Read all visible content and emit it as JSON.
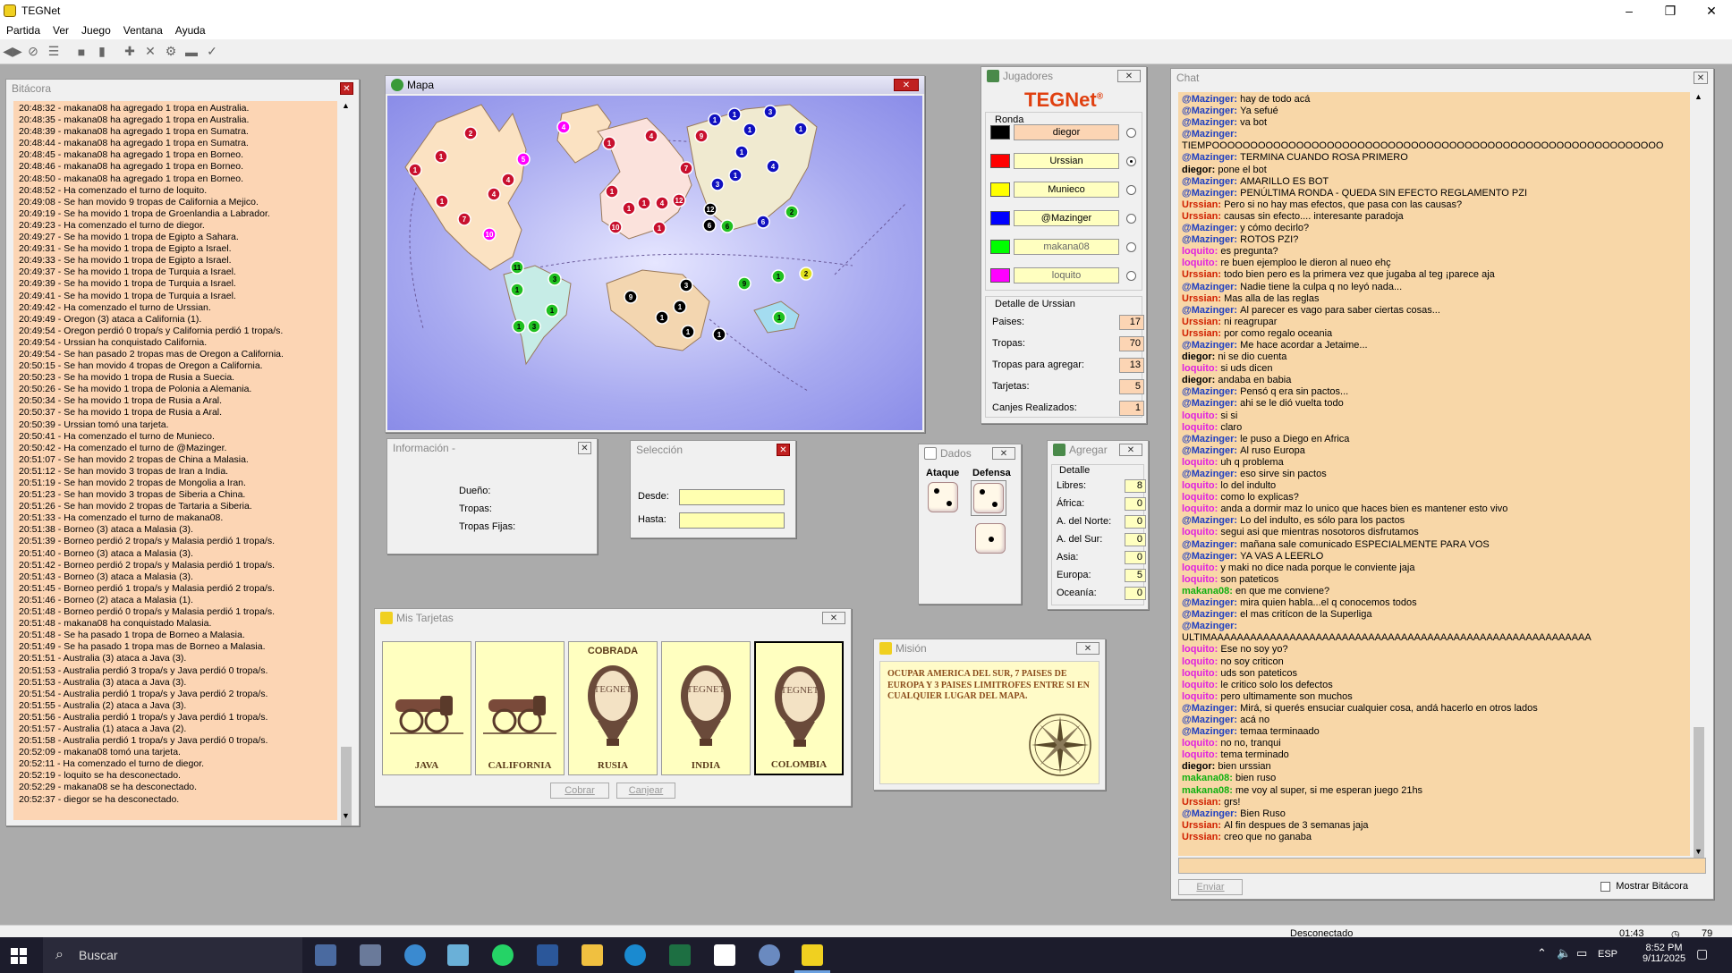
{
  "window": {
    "title": "TEGNet",
    "min": "–",
    "max": "❐",
    "close": "✕"
  },
  "menu": [
    "Partida",
    "Ver",
    "Juego",
    "Ventana",
    "Ayuda"
  ],
  "log": {
    "title": "Bitácora",
    "lines": [
      "20:48:32 - makana08 ha agregado 1 tropa en Australia.",
      "20:48:35 - makana08 ha agregado 1 tropa en Australia.",
      "20:48:39 - makana08 ha agregado 1 tropa en Sumatra.",
      "20:48:44 - makana08 ha agregado 1 tropa en Sumatra.",
      "20:48:45 - makana08 ha agregado 1 tropa en Borneo.",
      "20:48:46 - makana08 ha agregado 1 tropa en Borneo.",
      "20:48:50 - makana08 ha agregado 1 tropa en Borneo.",
      "20:48:52 - Ha comenzado el turno de loquito.",
      "20:49:08 - Se han movido 9 tropas de California a Mejico.",
      "20:49:19 - Se ha movido 1 tropa de Groenlandia a Labrador.",
      "20:49:23 - Ha comenzado el turno de diegor.",
      "20:49:27 - Se ha movido 1 tropa de Egipto a Sahara.",
      "20:49:31 - Se ha movido 1 tropa de Egipto a Israel.",
      "20:49:33 - Se ha movido 1 tropa de Egipto a Israel.",
      "20:49:37 - Se ha movido 1 tropa de Turquia a Israel.",
      "20:49:39 - Se ha movido 1 tropa de Turquia a Israel.",
      "20:49:41 - Se ha movido 1 tropa de Turquia a Israel.",
      "20:49:42 - Ha comenzado el turno de Urssian.",
      "20:49:49 - Oregon (3) ataca a California (1).",
      "20:49:54 - Oregon perdió 0 tropa/s y California perdió 1 tropa/s.",
      "20:49:54 - Urssian ha conquistado California.",
      "20:49:54 - Se han pasado 2 tropas mas de Oregon a California.",
      "20:50:15 - Se han movido 4 tropas de Oregon a California.",
      "20:50:23 - Se ha movido 1 tropa de Rusia a Suecia.",
      "20:50:26 - Se ha movido 1 tropa de Polonia a Alemania.",
      "20:50:34 - Se ha movido 1 tropa de Rusia a Aral.",
      "20:50:37 - Se ha movido 1 tropa de Rusia a Aral.",
      "20:50:39 - Urssian tomó una tarjeta.",
      "20:50:41 - Ha comenzado el turno de Munieco.",
      "20:50:42 - Ha comenzado el turno de @Mazinger.",
      "20:51:07 - Se han movido 2 tropas de China a Malasia.",
      "20:51:12 - Se han movido 3 tropas de Iran a India.",
      "20:51:19 - Se han movido 2 tropas de Mongolia a Iran.",
      "20:51:23 - Se han movido 3 tropas de Siberia a China.",
      "20:51:26 - Se han movido 2 tropas de Tartaria a Siberia.",
      "20:51:33 - Ha comenzado el turno de makana08.",
      "20:51:38 - Borneo (3) ataca a Malasia (3).",
      "20:51:39 - Borneo perdió 2 tropa/s y Malasia perdió 1 tropa/s.",
      "20:51:40 - Borneo (3) ataca a Malasia (3).",
      "20:51:42 - Borneo perdió 2 tropa/s y Malasia perdió 1 tropa/s.",
      "20:51:43 - Borneo (3) ataca a Malasia (3).",
      "20:51:45 - Borneo perdió 1 tropa/s y Malasia perdió 2 tropa/s.",
      "20:51:46 - Borneo (2) ataca a Malasia (1).",
      "20:51:48 - Borneo perdió 0 tropa/s y Malasia perdió 1 tropa/s.",
      "20:51:48 - makana08 ha conquistado Malasia.",
      "20:51:48 - Se ha pasado 1 tropa de Borneo a Malasia.",
      "20:51:49 - Se ha pasado 1 tropa mas de Borneo a Malasia.",
      "20:51:51 - Australia (3) ataca a Java (3).",
      "20:51:53 - Australia perdió 3 tropa/s y Java perdió 0 tropa/s.",
      "20:51:53 - Australia (3) ataca a Java (3).",
      "20:51:54 - Australia perdió 1 tropa/s y Java perdió 2 tropa/s.",
      "20:51:55 - Australia (2) ataca a Java (3).",
      "20:51:56 - Australia perdió 1 tropa/s y Java perdió 1 tropa/s.",
      "20:51:57 - Australia (1) ataca a Java (2).",
      "20:51:58 - Australia perdió 1 tropa/s y Java perdió 0 tropa/s.",
      "20:52:09 - makana08 tomó una tarjeta.",
      "20:52:11 - Ha comenzado el turno de diegor.",
      "20:52:19 - loquito se ha desconectado.",
      "20:52:29 - makana08 se ha desconectado.",
      "20:52:37 - diegor se ha desconectado."
    ]
  },
  "map": {
    "title": "Mapa",
    "markers": [
      {
        "n": "2",
        "c": "#c8102e"
      },
      {
        "n": "1",
        "c": "#c8102e"
      },
      {
        "n": "1",
        "c": "#c8102e"
      },
      {
        "n": "4",
        "c": "#c8102e"
      },
      {
        "n": "4",
        "c": "#c8102e"
      },
      {
        "n": "1",
        "c": "#c8102e"
      },
      {
        "n": "7",
        "c": "#c8102e"
      },
      {
        "n": "5",
        "c": "#ff00ff"
      },
      {
        "n": "4",
        "c": "#ff00ff"
      },
      {
        "n": "10",
        "c": "#ff00ff"
      },
      {
        "n": "1",
        "c": "#c8102e"
      },
      {
        "n": "4",
        "c": "#c8102e"
      },
      {
        "n": "1",
        "c": "#c8102e"
      },
      {
        "n": "7",
        "c": "#c8102e"
      },
      {
        "n": "9",
        "c": "#c8102e"
      },
      {
        "n": "4",
        "c": "#c8102e"
      },
      {
        "n": "1",
        "c": "#c8102e"
      },
      {
        "n": "12",
        "c": "#c8102e"
      },
      {
        "n": "10",
        "c": "#c8102e"
      },
      {
        "n": "1",
        "c": "#c8102e"
      },
      {
        "n": "1",
        "c": "#c8102e"
      },
      {
        "n": "1",
        "c": "#1010c0"
      },
      {
        "n": "1",
        "c": "#1010c0"
      },
      {
        "n": "1",
        "c": "#1010c0"
      },
      {
        "n": "3",
        "c": "#1010c0"
      },
      {
        "n": "1",
        "c": "#1010c0"
      },
      {
        "n": "1",
        "c": "#1010c0"
      },
      {
        "n": "1",
        "c": "#1010c0"
      },
      {
        "n": "4",
        "c": "#1010c0"
      },
      {
        "n": "3",
        "c": "#1010c0"
      },
      {
        "n": "6",
        "c": "#1010c0"
      },
      {
        "n": "2",
        "c": "#20c020"
      },
      {
        "n": "12",
        "c": "#000000"
      },
      {
        "n": "6",
        "c": "#000000"
      },
      {
        "n": "6",
        "c": "#20c020"
      },
      {
        "n": "11",
        "c": "#20c020"
      },
      {
        "n": "3",
        "c": "#20c020"
      },
      {
        "n": "1",
        "c": "#20c020"
      },
      {
        "n": "1",
        "c": "#20c020"
      },
      {
        "n": "1",
        "c": "#20c020"
      },
      {
        "n": "3",
        "c": "#20c020"
      },
      {
        "n": "3",
        "c": "#000000"
      },
      {
        "n": "9",
        "c": "#000000"
      },
      {
        "n": "1",
        "c": "#000000"
      },
      {
        "n": "1",
        "c": "#000000"
      },
      {
        "n": "1",
        "c": "#000000"
      },
      {
        "n": "1",
        "c": "#000000"
      },
      {
        "n": "9",
        "c": "#20c020"
      },
      {
        "n": "1",
        "c": "#20c020"
      },
      {
        "n": "2",
        "c": "#e0e020"
      },
      {
        "n": "1",
        "c": "#20c020"
      }
    ]
  },
  "info": {
    "title": "Información -",
    "owner": "Dueño:",
    "troops": "Tropas:",
    "fixed": "Tropas Fijas:"
  },
  "selection": {
    "title": "Selección",
    "from": "Desde:",
    "to": "Hasta:"
  },
  "players": {
    "title": "Jugadores",
    "logo": "TEGNet",
    "logo_reg": "®",
    "round_label": "Ronda",
    "list": [
      {
        "name": "diegor",
        "color": "#000000",
        "active": false,
        "highlight": true
      },
      {
        "name": "Urssian",
        "color": "#ff0000",
        "active": true,
        "highlight": false
      },
      {
        "name": "Munieco",
        "color": "#ffff00",
        "active": false,
        "highlight": false
      },
      {
        "name": "@Mazinger",
        "color": "#0000ff",
        "active": false,
        "highlight": false
      },
      {
        "name": "makana08",
        "color": "#00ff00",
        "active": false,
        "highlight": false
      },
      {
        "name": "loquito",
        "color": "#ff00ff",
        "active": false,
        "highlight": false
      }
    ],
    "detail_title": "Detalle de Urssian",
    "stats": [
      {
        "label": "Paises:",
        "value": "17"
      },
      {
        "label": "Tropas:",
        "value": "70"
      },
      {
        "label": "Tropas para agregar:",
        "value": "13"
      },
      {
        "label": "Tarjetas:",
        "value": "5"
      },
      {
        "label": "Canjes Realizados:",
        "value": "1"
      }
    ]
  },
  "dice": {
    "title": "Dados",
    "attack": "Ataque",
    "defense": "Defensa"
  },
  "add": {
    "title": "Agregar",
    "detail": "Detalle",
    "rows": [
      {
        "label": "Libres:",
        "value": "8"
      },
      {
        "label": "África:",
        "value": "0"
      },
      {
        "label": "A. del Norte:",
        "value": "0"
      },
      {
        "label": "A. del Sur:",
        "value": "0"
      },
      {
        "label": "Asia:",
        "value": "0"
      },
      {
        "label": "Europa:",
        "value": "5"
      },
      {
        "label": "Oceanía:",
        "value": "0"
      }
    ]
  },
  "cards": {
    "title": "Mis Tarjetas",
    "list": [
      {
        "name": "JAVA",
        "kind": "canon",
        "top": ""
      },
      {
        "name": "CALIFORNIA",
        "kind": "canon",
        "top": ""
      },
      {
        "name": "RUSIA",
        "kind": "balloon",
        "top": "COBRADA"
      },
      {
        "name": "INDIA",
        "kind": "balloon",
        "top": ""
      },
      {
        "name": "COLOMBIA",
        "kind": "balloon",
        "top": ""
      }
    ],
    "balloon_text": "TEGNET",
    "collect": "Cobrar",
    "exchange": "Canjear"
  },
  "mission": {
    "title": "Misión",
    "text": "OCUPAR AMERICA DEL SUR, 7 PAISES DE EUROPA Y 3 PAISES LIMITROFES ENTRE SI EN CUALQUIER LUGAR DEL MAPA."
  },
  "chat": {
    "title": "Chat",
    "send": "Enviar",
    "show_log": "Mostrar Bitácora",
    "lines": [
      {
        "u": "@Mazinger:",
        "c": "#2040c0",
        "m": "hay de todo acá"
      },
      {
        "u": "@Mazinger:",
        "c": "#2040c0",
        "m": "Ya sefué"
      },
      {
        "u": "@Mazinger:",
        "c": "#2040c0",
        "m": "va bot"
      },
      {
        "u": "@Mazinger:",
        "c": "#2040c0",
        "m": ""
      },
      {
        "u": "",
        "c": "#000",
        "m": "TIEMPOOOOOOOOOOOOOOOOOOOOOOOOOOOOOOOOOOOOOOOOOOOOOOOOOOOOOOOOOOO"
      },
      {
        "u": "@Mazinger:",
        "c": "#2040c0",
        "m": "TERMINA CUANDO ROSA PRIMERO"
      },
      {
        "u": "diegor:",
        "c": "#000",
        "m": "pone el bot"
      },
      {
        "u": "@Mazinger:",
        "c": "#2040c0",
        "m": "AMARILLO ES BOT"
      },
      {
        "u": "@Mazinger:",
        "c": "#2040c0",
        "m": "PENÚLTIMA RONDA - QUEDA SIN EFECTO REGLAMENTO PZI"
      },
      {
        "u": "Urssian:",
        "c": "#d02000",
        "m": "Pero si no hay mas efectos, que pasa con las causas?"
      },
      {
        "u": "Urssian:",
        "c": "#d02000",
        "m": "causas sin efecto.... interesante paradoja"
      },
      {
        "u": "@Mazinger:",
        "c": "#2040c0",
        "m": "y cómo decirlo?"
      },
      {
        "u": "@Mazinger:",
        "c": "#2040c0",
        "m": "ROTOS PZI?"
      },
      {
        "u": "loquito:",
        "c": "#e020e0",
        "m": "es pregunta?"
      },
      {
        "u": "loquito:",
        "c": "#e020e0",
        "m": "re buen ejemploo le dieron al nueo ehç"
      },
      {
        "u": "Urssian:",
        "c": "#d02000",
        "m": "todo bien pero es la primera vez que jugaba al teg ¡parece aja"
      },
      {
        "u": "@Mazinger:",
        "c": "#2040c0",
        "m": "Nadie tiene la culpa q no leyó nada..."
      },
      {
        "u": "Urssian:",
        "c": "#d02000",
        "m": "Mas alla de las reglas"
      },
      {
        "u": "@Mazinger:",
        "c": "#2040c0",
        "m": "Al parecer es vago para saber ciertas cosas..."
      },
      {
        "u": "Urssian:",
        "c": "#d02000",
        "m": "ni reagrupar"
      },
      {
        "u": "Urssian:",
        "c": "#d02000",
        "m": "por como regalo oceania"
      },
      {
        "u": "@Mazinger:",
        "c": "#2040c0",
        "m": "Me hace acordar a Jetaime..."
      },
      {
        "u": "diegor:",
        "c": "#000",
        "m": "ni se dio cuenta"
      },
      {
        "u": "loquito:",
        "c": "#e020e0",
        "m": "si uds dicen"
      },
      {
        "u": "diegor:",
        "c": "#000",
        "m": "andaba en babia"
      },
      {
        "u": "@Mazinger:",
        "c": "#2040c0",
        "m": "Pensó q era sin pactos..."
      },
      {
        "u": "@Mazinger:",
        "c": "#2040c0",
        "m": "ahi se le dió vuelta todo"
      },
      {
        "u": "loquito:",
        "c": "#e020e0",
        "m": "si si"
      },
      {
        "u": "loquito:",
        "c": "#e020e0",
        "m": "claro"
      },
      {
        "u": "@Mazinger:",
        "c": "#2040c0",
        "m": "le puso a Diego en Africa"
      },
      {
        "u": "@Mazinger:",
        "c": "#2040c0",
        "m": "Al ruso Europa"
      },
      {
        "u": "loquito:",
        "c": "#e020e0",
        "m": "uh q problema"
      },
      {
        "u": "@Mazinger:",
        "c": "#2040c0",
        "m": "eso sirve sin pactos"
      },
      {
        "u": "loquito:",
        "c": "#e020e0",
        "m": "lo del indulto"
      },
      {
        "u": "loquito:",
        "c": "#e020e0",
        "m": "como lo explicas?"
      },
      {
        "u": "loquito:",
        "c": "#e020e0",
        "m": "anda a dormir maz lo unico que haces bien es mantener esto vivo"
      },
      {
        "u": "@Mazinger:",
        "c": "#2040c0",
        "m": "Lo del indulto, es sólo para los pactos"
      },
      {
        "u": "loquito:",
        "c": "#e020e0",
        "m": "segui asi que mientras nosotoros disfrutamos"
      },
      {
        "u": "@Mazinger:",
        "c": "#2040c0",
        "m": "mañana sale comunicado ESPECIALMENTE PARA VOS"
      },
      {
        "u": "@Mazinger:",
        "c": "#2040c0",
        "m": "YA VAS A LEERLO"
      },
      {
        "u": "loquito:",
        "c": "#e020e0",
        "m": "y maki no dice nada porque le conviente jaja"
      },
      {
        "u": "loquito:",
        "c": "#e020e0",
        "m": "son pateticos"
      },
      {
        "u": "makana08:",
        "c": "#10b010",
        "m": "en que me conviene?"
      },
      {
        "u": "@Mazinger:",
        "c": "#2040c0",
        "m": "mira quien habla...el q conocemos todos"
      },
      {
        "u": "@Mazinger:",
        "c": "#2040c0",
        "m": "el mas critícon de la Superliga"
      },
      {
        "u": "@Mazinger:",
        "c": "#2040c0",
        "m": ""
      },
      {
        "u": "",
        "c": "#000",
        "m": "ULTIMAAAAAAAAAAAAAAAAAAAAAAAAAAAAAAAAAAAAAAAAAAAAAAAAAAAAAAAAAA"
      },
      {
        "u": "loquito:",
        "c": "#e020e0",
        "m": "Ese no soy yo?"
      },
      {
        "u": "loquito:",
        "c": "#e020e0",
        "m": "no soy criticon"
      },
      {
        "u": "loquito:",
        "c": "#e020e0",
        "m": "uds son pateticos"
      },
      {
        "u": "loquito:",
        "c": "#e020e0",
        "m": "le critico solo los defectos"
      },
      {
        "u": "loquito:",
        "c": "#e020e0",
        "m": "pero ultimamente son muchos"
      },
      {
        "u": "@Mazinger:",
        "c": "#2040c0",
        "m": "Mirá, si querés ensuciar cualquier cosa, andá hacerlo en otros lados"
      },
      {
        "u": "@Mazinger:",
        "c": "#2040c0",
        "m": "acá no"
      },
      {
        "u": "@Mazinger:",
        "c": "#2040c0",
        "m": "temaa terminaado"
      },
      {
        "u": "loquito:",
        "c": "#e020e0",
        "m": "no no, tranqui"
      },
      {
        "u": "loquito:",
        "c": "#e020e0",
        "m": "tema terminado"
      },
      {
        "u": "diegor:",
        "c": "#000",
        "m": "bien urssian"
      },
      {
        "u": "makana08:",
        "c": "#10b010",
        "m": "bien ruso"
      },
      {
        "u": "makana08:",
        "c": "#10b010",
        "m": "me voy al super, si me esperan juego 21hs"
      },
      {
        "u": "Urssian:",
        "c": "#d02000",
        "m": "grs!"
      },
      {
        "u": "@Mazinger:",
        "c": "#2040c0",
        "m": "Bien Ruso"
      },
      {
        "u": "Urssian:",
        "c": "#d02000",
        "m": "Al fin despues de 3 semanas jaja"
      },
      {
        "u": "Urssian:",
        "c": "#d02000",
        "m": "creo que no ganaba"
      }
    ]
  },
  "status": {
    "state": "Desconectado",
    "time": "01:43",
    "count": "79"
  },
  "taskbar": {
    "search": "Buscar",
    "lang": "ESP",
    "clock": "8:52 PM",
    "date": "9/11/2025"
  }
}
